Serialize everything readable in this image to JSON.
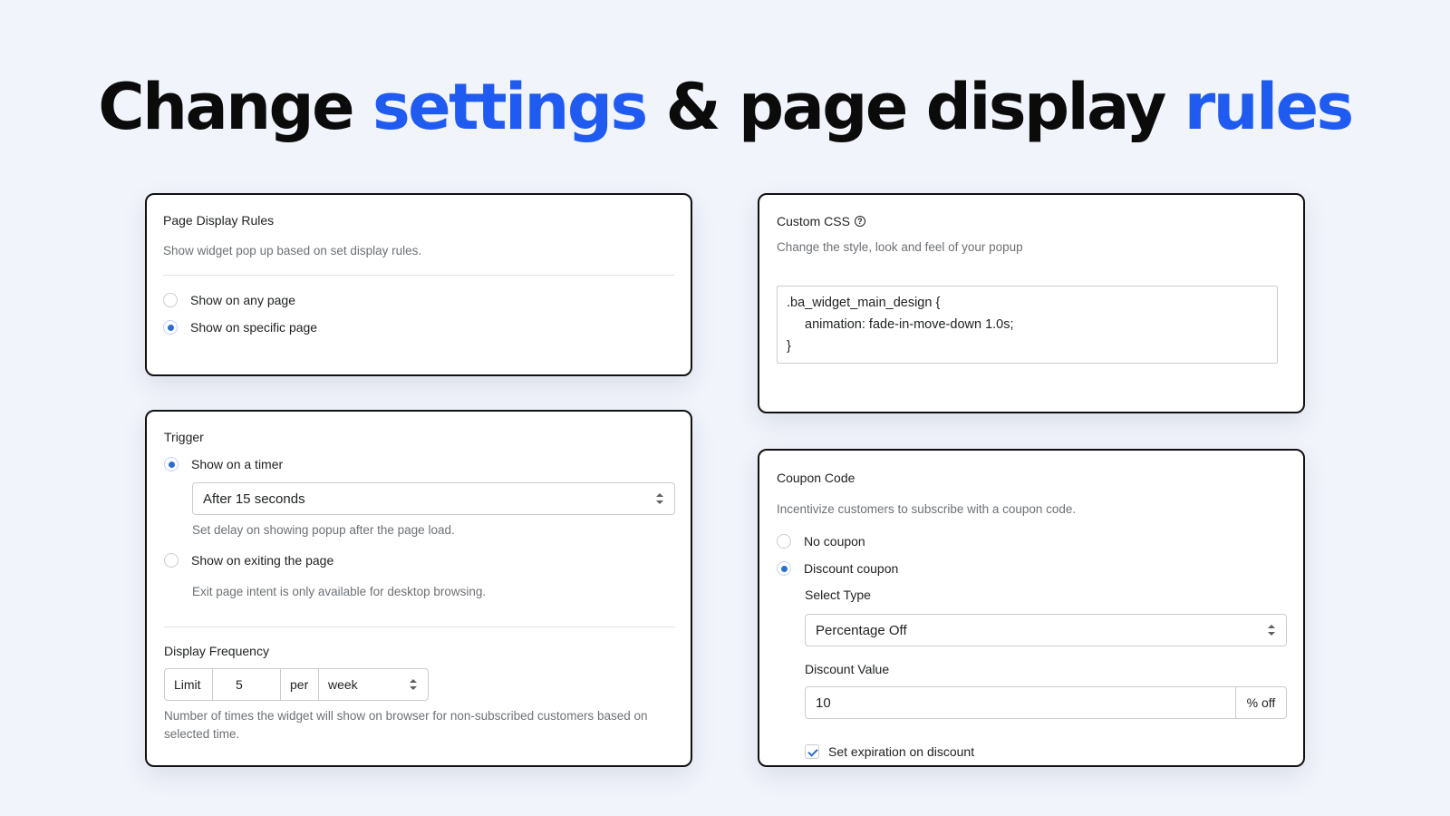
{
  "headline": {
    "part1": "Change ",
    "accent1": "settings",
    "part2": " & page display ",
    "accent2": "rules"
  },
  "page_display_rules": {
    "title": "Page Display Rules",
    "description": "Show widget pop up based on set display rules.",
    "options": [
      {
        "label": "Show on any page",
        "checked": false
      },
      {
        "label": "Show on specific page",
        "checked": true
      }
    ]
  },
  "trigger": {
    "title": "Trigger",
    "timer_option": {
      "label": "Show on a timer",
      "checked": true
    },
    "timer_select": "After 15 seconds",
    "timer_help": "Set delay on showing popup after the page load.",
    "exit_option": {
      "label": "Show on exiting the page",
      "checked": false
    },
    "exit_help": "Exit page intent is only available for desktop browsing.",
    "frequency_title": "Display Frequency",
    "frequency": {
      "limit_label": "Limit",
      "limit_value": "5",
      "per_label": "per",
      "period": "week"
    },
    "frequency_help": "Number of times the widget will show on browser for non-subscribed customers based on selected time."
  },
  "custom_css": {
    "title": "Custom CSS",
    "help_icon": "question-circle-icon",
    "description": "Change the style, look and feel of your popup",
    "code_lines": [
      ".ba_widget_main_design {",
      "animation: fade-in-move-down 1.0s;",
      "}"
    ]
  },
  "coupon_code": {
    "title": "Coupon Code",
    "description": "Incentivize customers to subscribe with a coupon code.",
    "options": [
      {
        "label": "No coupon",
        "checked": false
      },
      {
        "label": "Discount coupon",
        "checked": true
      }
    ],
    "select_type_label": "Select Type",
    "select_type_value": "Percentage Off",
    "discount_value_label": "Discount Value",
    "discount_value": "10",
    "discount_suffix": "% off",
    "expiration_label": "Set expiration on discount",
    "expiration_checked": true
  },
  "colors": {
    "accent": "#1f5bf0",
    "radio_selected": "#2c6ecb",
    "background": "#f1f4fb"
  }
}
